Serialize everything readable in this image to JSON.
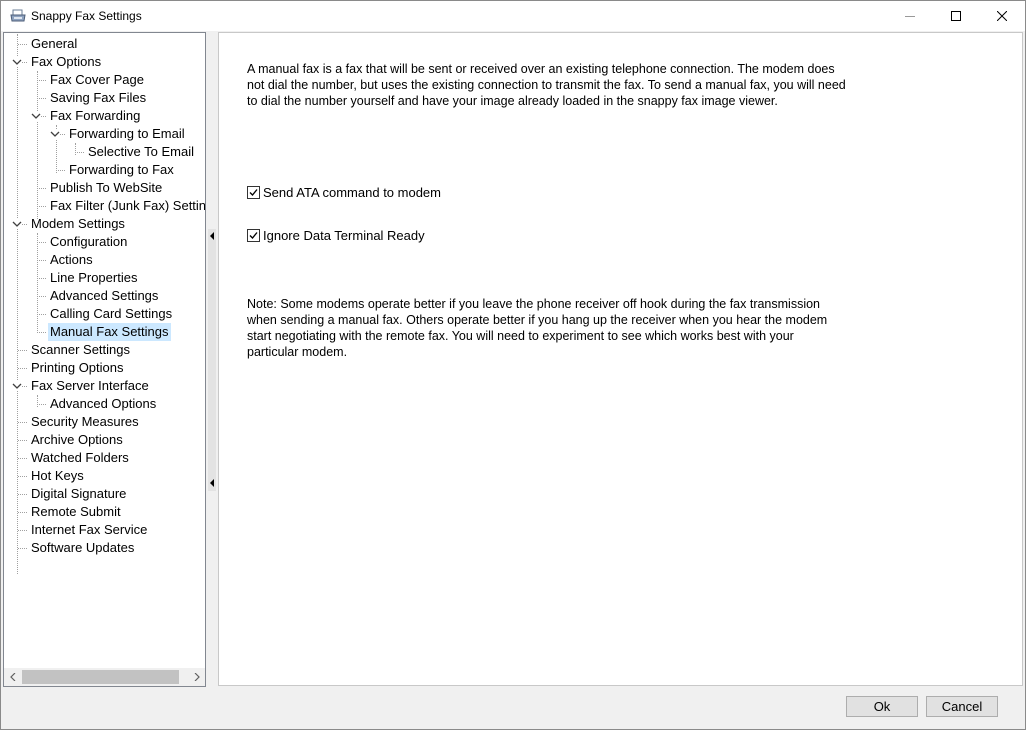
{
  "window": {
    "title": "Snappy Fax Settings"
  },
  "icons": {
    "app": "fax-printer-icon",
    "minimize": "minimize-icon",
    "maximize": "maximize-icon",
    "close": "close-icon"
  },
  "tree": {
    "items": [
      {
        "label": "General",
        "expander": ""
      },
      {
        "label": "Fax Options",
        "expander": "expanded"
      },
      {
        "label": "Fax Cover Page",
        "expander": ""
      },
      {
        "label": "Saving Fax Files",
        "expander": ""
      },
      {
        "label": "Fax Forwarding",
        "expander": "expanded"
      },
      {
        "label": "Forwarding to Email",
        "expander": "expanded"
      },
      {
        "label": "Selective To Email",
        "expander": ""
      },
      {
        "label": "Forwarding to Fax",
        "expander": ""
      },
      {
        "label": "Publish To WebSite",
        "expander": ""
      },
      {
        "label": "Fax Filter (Junk Fax) Settings",
        "expander": ""
      },
      {
        "label": "Modem Settings",
        "expander": "expanded"
      },
      {
        "label": "Configuration",
        "expander": ""
      },
      {
        "label": "Actions",
        "expander": ""
      },
      {
        "label": "Line Properties",
        "expander": ""
      },
      {
        "label": "Advanced Settings",
        "expander": ""
      },
      {
        "label": "Calling Card Settings",
        "expander": ""
      },
      {
        "label": "Manual Fax Settings",
        "expander": "",
        "selected": true
      },
      {
        "label": "Scanner Settings",
        "expander": ""
      },
      {
        "label": "Printing Options",
        "expander": ""
      },
      {
        "label": "Fax Server Interface",
        "expander": "expanded"
      },
      {
        "label": "Advanced Options",
        "expander": ""
      },
      {
        "label": "Security Measures",
        "expander": ""
      },
      {
        "label": "Archive Options",
        "expander": ""
      },
      {
        "label": "Watched Folders",
        "expander": ""
      },
      {
        "label": "Hot Keys",
        "expander": ""
      },
      {
        "label": "Digital Signature",
        "expander": ""
      },
      {
        "label": "Remote Submit",
        "expander": ""
      },
      {
        "label": "Internet Fax Service",
        "expander": ""
      },
      {
        "label": "Software Updates",
        "expander": ""
      }
    ]
  },
  "content": {
    "intro": "A manual fax is a fax that will be sent or received over an existing telephone connection.  The modem does not dial the number, but uses the existing connection to transmit the fax.  To send a manual fax, you will need to dial the number yourself and have your image already loaded in the snappy fax image viewer.",
    "checkboxes": [
      {
        "label": "Send ATA command to modem",
        "checked": true
      },
      {
        "label": "Ignore Data Terminal Ready",
        "checked": true
      }
    ],
    "note": "Note: Some modems operate better if you leave the phone receiver off hook during the fax transmission when sending a manual fax.  Others operate better if you hang up the receiver when you hear the modem start negotiating with the remote fax.  You will need to experiment to see which works best with your particular modem."
  },
  "buttons": {
    "ok": "Ok",
    "cancel": "Cancel"
  },
  "colors": {
    "selection": "#cce8ff"
  }
}
